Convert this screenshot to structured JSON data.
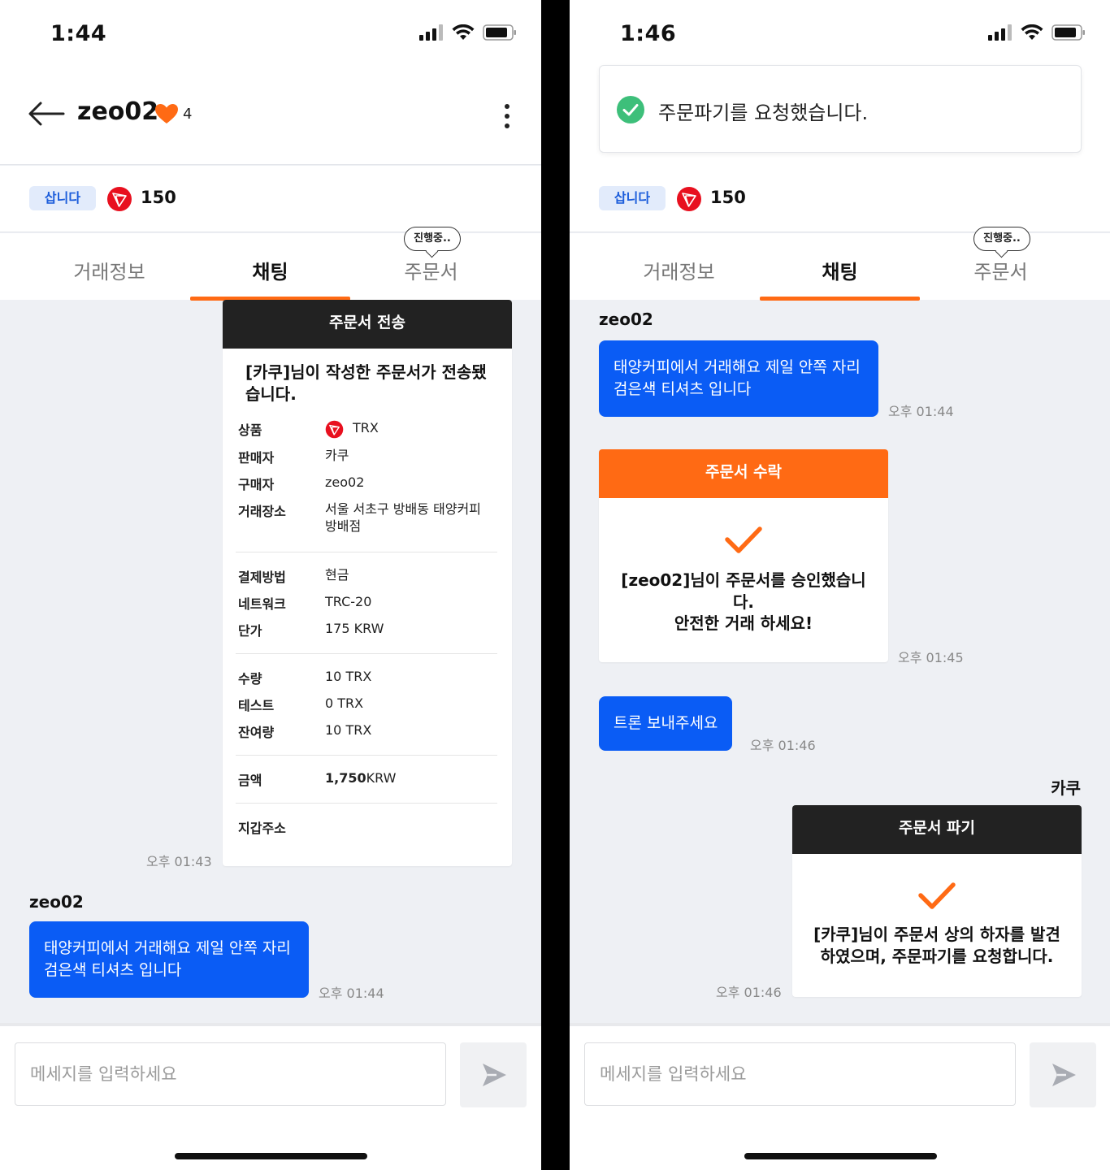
{
  "left": {
    "status_time": "1:44",
    "header": {
      "title": "zeo02",
      "likes": "4"
    },
    "info": {
      "badge": "삽니다",
      "amount": "150"
    },
    "tabs": [
      {
        "label": "거래정보"
      },
      {
        "label": "채팅"
      },
      {
        "label": "주문서"
      }
    ],
    "tab_bubble": "진행중..",
    "order_card": {
      "header": "주문서 전송",
      "title": "[카쿠]님이 작성한 주문서가 전송됐습니다.",
      "rows": [
        {
          "label": "상품",
          "value": "TRX"
        },
        {
          "label": "판매자",
          "value": "카쿠"
        },
        {
          "label": "구매자",
          "value": "zeo02"
        },
        {
          "label": "거래장소",
          "value": "서울 서초구 방배동 태양커피 방배점"
        },
        {
          "label": "결제방법",
          "value": "현금"
        },
        {
          "label": "네트워크",
          "value": "TRC-20"
        },
        {
          "label": "단가",
          "value": "175 KRW"
        },
        {
          "label": "수량",
          "value": "10 TRX"
        },
        {
          "label": "테스트",
          "value": "0 TRX"
        },
        {
          "label": "잔여량",
          "value": "10 TRX"
        },
        {
          "label": "금액",
          "value_bold": "1,750",
          "value_unit": "KRW"
        },
        {
          "label": "지갑주소",
          "value": ""
        }
      ],
      "time": "오후 01:43"
    },
    "message": {
      "sender": "zeo02",
      "text": "태양커피에서 거래해요 제일 안쪽 자리 검은색 티셔츠 입니다",
      "time": "오후 01:44"
    },
    "input_placeholder": "메세지를 입력하세요"
  },
  "right": {
    "status_time": "1:46",
    "toast": "주문파기를 요청했습니다.",
    "info": {
      "badge": "삽니다",
      "amount": "150"
    },
    "tabs": [
      {
        "label": "거래정보"
      },
      {
        "label": "채팅"
      },
      {
        "label": "주문서"
      }
    ],
    "tab_bubble": "진행중..",
    "sender_top": "zeo02",
    "message1": {
      "text": "태양커피에서 거래해요 제일 안쪽 자리 검은색 티셔츠 입니다",
      "time": "오후 01:44"
    },
    "accept_card": {
      "header": "주문서 수락",
      "line1": "[zeo02]님이 주문서를 승인했습니다.",
      "line2": "안전한 거래 하세요!",
      "time": "오후 01:45"
    },
    "message2": {
      "text": "트론 보내주세요",
      "time": "오후 01:46"
    },
    "sender_bottom": "카쿠",
    "cancel_card": {
      "header": "주문서 파기",
      "text": "[카쿠]님이 주문서 상의 하자를 발견하였으며, 주문파기를 요청합니다.",
      "time": "오후 01:46"
    },
    "input_placeholder": "메세지를 입력하세요"
  },
  "colors": {
    "accent": "#ff6a14",
    "bubble_blue": "#0a5cf5",
    "badge_blue": "#1c5ddb",
    "trx_red": "#e8101f",
    "success_green": "#3dbf7a"
  }
}
